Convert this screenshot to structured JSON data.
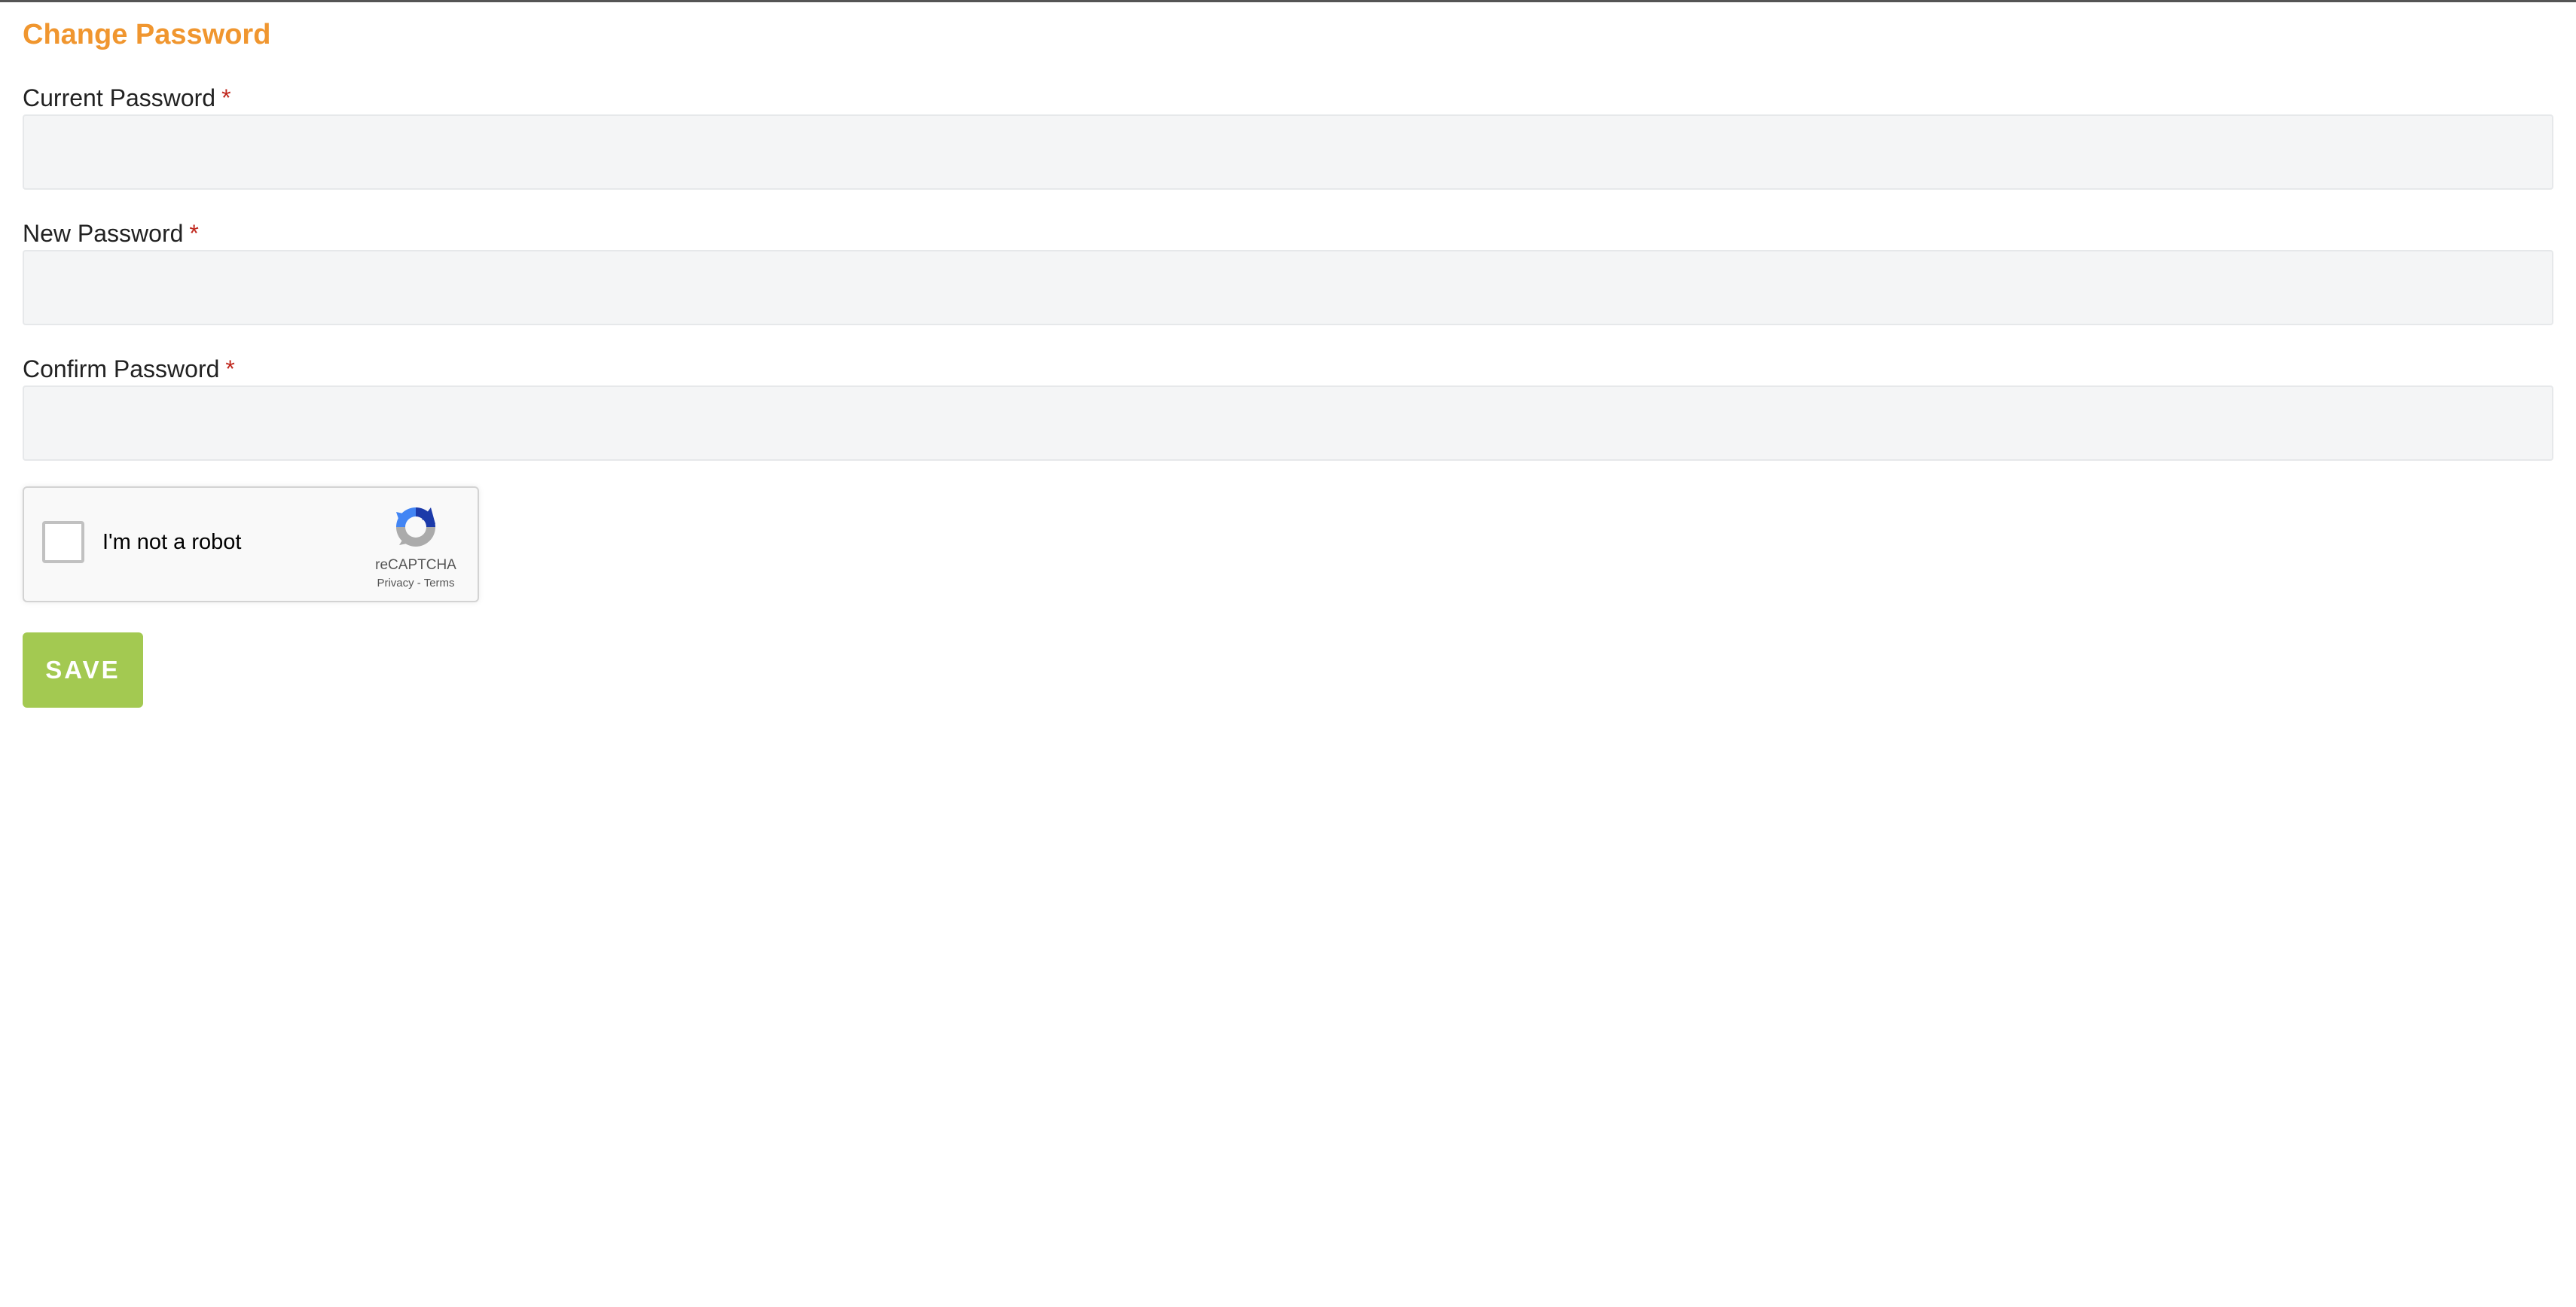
{
  "page": {
    "title": "Change Password"
  },
  "form": {
    "fields": [
      {
        "label": "Current Password",
        "required_marker": "*",
        "value": "",
        "placeholder": ""
      },
      {
        "label": "New Password",
        "required_marker": "*",
        "value": "",
        "placeholder": ""
      },
      {
        "label": "Confirm Password",
        "required_marker": "*",
        "value": "",
        "placeholder": ""
      }
    ],
    "save_label": "SAVE"
  },
  "recaptcha": {
    "label": "I'm not a robot",
    "brand": "reCAPTCHA",
    "privacy_label": "Privacy",
    "separator": "-",
    "terms_label": "Terms",
    "checked": false,
    "icon": "recaptcha-logo-icon"
  },
  "colors": {
    "title": "#f0962f",
    "required": "#c0281e",
    "save_button": "#a3c951",
    "input_background": "#f4f5f6"
  }
}
